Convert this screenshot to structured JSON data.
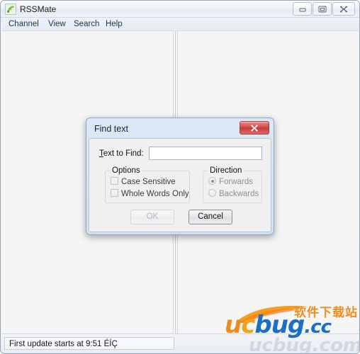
{
  "window": {
    "title": "RSSMate",
    "icon": "rss-signal-icon",
    "controls": {
      "minimize": "Minimize",
      "maximize": "Maximize",
      "close": "Close"
    }
  },
  "menu": {
    "items": [
      {
        "label": "Channel"
      },
      {
        "label": "View"
      },
      {
        "label": "Search"
      },
      {
        "label": "Help"
      }
    ]
  },
  "status_bar": {
    "message": "First update starts at 9:51 ÉÍÇ"
  },
  "watermark": {
    "cn_text": "软件下载站",
    "brand_u": "u",
    "brand_c": "c",
    "brand_bug": "bug",
    "brand_dot": ".",
    "brand_cc": "cc",
    "ghost": "ucbug.com"
  },
  "dialog": {
    "title": "Find text",
    "close_label": "Close",
    "text_to_find": {
      "label_prefix": "",
      "label_mnemonic": "T",
      "label_rest": "ext to Find:",
      "value": "",
      "placeholder": ""
    },
    "options": {
      "title": "Options",
      "items": [
        {
          "label": "Case Sensitive",
          "checked": false,
          "enabled": false
        },
        {
          "label": "Whole Words Only",
          "checked": false,
          "enabled": false
        }
      ]
    },
    "direction": {
      "title": "Direction",
      "items": [
        {
          "label": "Forwards",
          "checked": true,
          "enabled": false
        },
        {
          "label": "Backwards",
          "checked": false,
          "enabled": false
        }
      ]
    },
    "buttons": {
      "ok": "OK",
      "cancel": "Cancel"
    }
  },
  "colors": {
    "dialog_frame": "#8fa8c8",
    "dialog_titlebar": "#cfe0f2",
    "close_red": "#c83838",
    "brand_orange": "#f08a1c",
    "brand_blue": "#1b6fc4",
    "app_icon_green": "#5aa02c"
  }
}
